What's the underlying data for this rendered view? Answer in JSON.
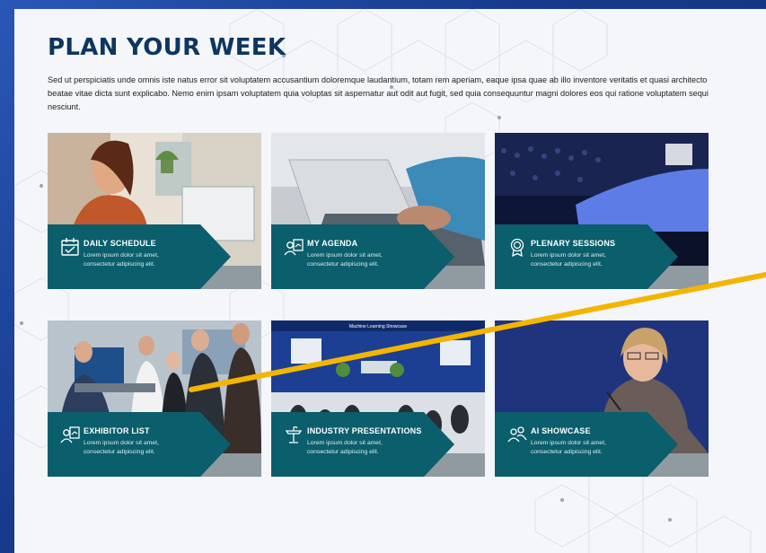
{
  "page": {
    "title": "PLAN YOUR WEEK",
    "intro": "Sed ut perspiciatis unde omnis iste natus error sit voluptatem accusantium doloremque laudantium, totam rem aperiam, eaque ipsa quae ab illo inventore veritatis et quasi architecto beatae vitae dicta sunt explicabo. Nemo enim ipsam voluptatem quia voluptas sit aspernatur aut odit aut fugit, sed quia consequuntur magni dolores eos qui ratione voluptatem sequi nesciunt."
  },
  "cards": [
    {
      "title": "DAILY SCHEDULE",
      "desc": "Lorem ipsum dolor sit amet, consectetur adipiscing elit.",
      "icon": "calendar-icon"
    },
    {
      "title": "MY AGENDA",
      "desc": "Lorem ipsum dolor sit amet, consectetur adipiscing elit.",
      "icon": "agenda-person-icon"
    },
    {
      "title": "PLENARY SESSIONS",
      "desc": "Lorem ipsum dolor sit amet, consectetur adipiscing elit.",
      "icon": "award-medal-icon"
    },
    {
      "title": "EXHIBITOR LIST",
      "desc": "Lorem ipsum dolor sit amet, consectetur adipiscing elit.",
      "icon": "exhibitor-person-icon"
    },
    {
      "title": "INDUSTRY PRESENTATIONS",
      "desc": "Lorem ipsum dolor sit amet, consectetur adipiscing elit.",
      "icon": "podium-icon"
    },
    {
      "title": "AI SHOWCASE",
      "desc": "Lorem ipsum dolor sit amet, consectetur adipiscing elit.",
      "icon": "people-group-icon"
    }
  ],
  "photos": {
    "industry_banner": "Machine Learning Showcase"
  },
  "colors": {
    "teal_banner": "#0b5e6b",
    "heading": "#0e3660",
    "pointer": "#f3b500",
    "frame": "#1b3f93"
  }
}
